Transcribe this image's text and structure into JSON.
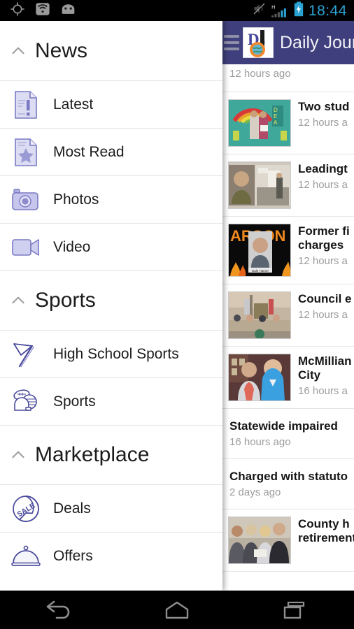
{
  "status_bar": {
    "time": "18:44",
    "time_color": "#2aa3d4",
    "left_icons": [
      "gps-crosshair-icon",
      "wifi-icon",
      "android-robot-icon"
    ],
    "right_icons": [
      "mute-icon",
      "signal-h-icon",
      "battery-charging-icon"
    ],
    "signal_label": "H"
  },
  "app_bar": {
    "title": "Daily Journ",
    "menu_icon": "hamburger-menu-icon",
    "logo_icon": "daily-journal-logo",
    "logo_letters": "DJ",
    "background": "#3f3f7d"
  },
  "drawer": {
    "sections": [
      {
        "title": "News",
        "chevron": "chevron-up-icon",
        "items": [
          {
            "label": "Latest",
            "icon": "document-alert-icon"
          },
          {
            "label": "Most Read",
            "icon": "document-star-icon"
          },
          {
            "label": "Photos",
            "icon": "camera-icon"
          },
          {
            "label": "Video",
            "icon": "video-camera-icon"
          }
        ]
      },
      {
        "title": "Sports",
        "chevron": "chevron-up-icon",
        "items": [
          {
            "label": "High School Sports",
            "icon": "pennant-flag-icon"
          },
          {
            "label": "Sports",
            "icon": "sports-balls-icon"
          }
        ]
      },
      {
        "title": "Marketplace",
        "chevron": "chevron-up-icon",
        "items": [
          {
            "label": "Deals",
            "icon": "sale-sticker-icon"
          },
          {
            "label": "Offers",
            "icon": "serving-cloche-icon"
          }
        ]
      }
    ]
  },
  "content_list": {
    "items": [
      {
        "title": "",
        "time": "12 hours ago",
        "thumb": false,
        "partial": true,
        "thumb_kind": ""
      },
      {
        "title": "Two stud",
        "time": "12 hours a",
        "thumb": true,
        "thumb_kind": "students-rainbow-photo"
      },
      {
        "title": "Leadingt",
        "time": "12 hours a",
        "thumb": true,
        "thumb_kind": "leadership-meeting-photo"
      },
      {
        "title": "Former fi",
        "title2": "charges",
        "time": "12 hours a",
        "thumb": true,
        "thumb_kind": "arson-mugshot-photo"
      },
      {
        "title": "Council e",
        "time": "12 hours a",
        "thumb": true,
        "thumb_kind": "council-meeting-photo"
      },
      {
        "title": "McMillian",
        "title2": "City",
        "time": "16 hours a",
        "thumb": true,
        "thumb_kind": "two-women-photo"
      },
      {
        "title": "Statewide impaired",
        "time": "16 hours ago",
        "thumb": false,
        "thumb_kind": ""
      },
      {
        "title": "Charged with statuto",
        "time": "2 days ago",
        "thumb": false,
        "thumb_kind": ""
      },
      {
        "title": "County h",
        "title2": "retirement",
        "time": "",
        "thumb": true,
        "thumb_kind": "group-award-photo"
      }
    ]
  },
  "nav_bar": {
    "buttons": [
      {
        "name": "back-button",
        "icon": "back-arrow-icon"
      },
      {
        "name": "home-button",
        "icon": "home-icon"
      },
      {
        "name": "recents-button",
        "icon": "recents-icon"
      }
    ]
  }
}
